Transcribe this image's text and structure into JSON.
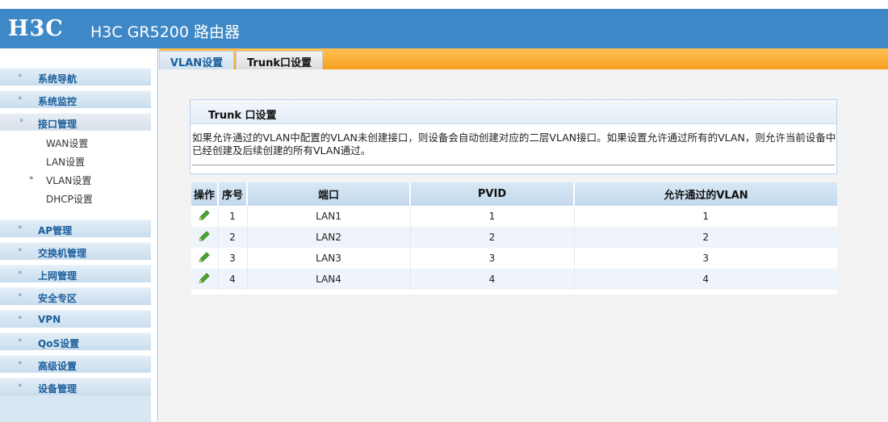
{
  "header": {
    "logo": "H3C",
    "product_name": "H3C GR5200 路由器"
  },
  "sidebar": {
    "items": [
      {
        "label": "系统导航",
        "icon": "double-chevron-right-icon"
      },
      {
        "label": "系统监控",
        "icon": "double-chevron-right-icon"
      },
      {
        "label": "接口管理",
        "icon": "double-chevron-down-icon",
        "expanded": true,
        "children": [
          "WAN设置",
          "LAN设置",
          "VLAN设置",
          "DHCP设置"
        ],
        "selected_child": "VLAN设置"
      },
      {
        "label": "AP管理",
        "icon": "double-chevron-right-icon"
      },
      {
        "label": "交换机管理",
        "icon": "double-chevron-right-icon"
      },
      {
        "label": "上网管理",
        "icon": "double-chevron-right-icon"
      },
      {
        "label": "安全专区",
        "icon": "double-chevron-right-icon"
      },
      {
        "label": "VPN",
        "icon": "double-chevron-right-icon"
      },
      {
        "label": "QoS设置",
        "icon": "double-chevron-right-icon"
      },
      {
        "label": "高级设置",
        "icon": "double-chevron-right-icon"
      },
      {
        "label": "设备管理",
        "icon": "double-chevron-right-icon"
      }
    ]
  },
  "tabs": [
    {
      "label": "VLAN设置",
      "active": false
    },
    {
      "label": "Trunk口设置",
      "active": true
    }
  ],
  "panel": {
    "title": "Trunk 口设置",
    "description": "如果允许通过的VLAN中配置的VLAN未创建接口，则设备会自动创建对应的二层VLAN接口。如果设置允许通过所有的VLAN，则允许当前设备中已经创建及后续创建的所有VLAN通过。"
  },
  "table": {
    "columns": [
      "操作",
      "序号",
      "端口",
      "PVID",
      "允许通过的VLAN"
    ],
    "rows": [
      {
        "index": "1",
        "port": "LAN1",
        "pvid": "1",
        "vlan": "1",
        "action_icon": "pencil-edit-icon"
      },
      {
        "index": "2",
        "port": "LAN2",
        "pvid": "2",
        "vlan": "2",
        "action_icon": "pencil-edit-icon"
      },
      {
        "index": "3",
        "port": "LAN3",
        "pvid": "3",
        "vlan": "3",
        "action_icon": "pencil-edit-icon"
      },
      {
        "index": "4",
        "port": "LAN4",
        "pvid": "4",
        "vlan": "4",
        "action_icon": "pencil-edit-icon"
      }
    ]
  },
  "colors": {
    "header_blue": "#3f88c7",
    "tab_orange": "#f7a021",
    "nav_text": "#1b5d9a",
    "edit_icon_green": "#3a9a2a"
  }
}
